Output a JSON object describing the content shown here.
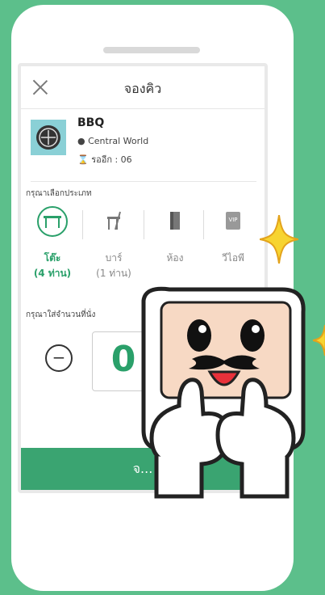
{
  "header": {
    "title": "จองคิว"
  },
  "shop": {
    "name": "BBQ",
    "location": "Central World",
    "queue": "รออีก : 06"
  },
  "select_label": "กรุณาเลือกประเภท",
  "types": [
    {
      "label": "โต๊ะ",
      "sub": "(4 ท่าน)",
      "active": true
    },
    {
      "label": "บาร์",
      "sub": "(1 ท่าน)",
      "active": false
    },
    {
      "label": "ห้อง",
      "sub": "",
      "active": false
    },
    {
      "label": "วีไอพี",
      "sub": "",
      "active": false
    }
  ],
  "vip_icon_text": "VIP",
  "count_label": "กรุณาใส่จำนวนที่นั่ง",
  "count": {
    "value": "0",
    "minus": "−"
  },
  "confirm_label": "จ...",
  "colors": {
    "bg": "#5cbf8b",
    "accent": "#2aa06a",
    "button": "#3aa471"
  }
}
